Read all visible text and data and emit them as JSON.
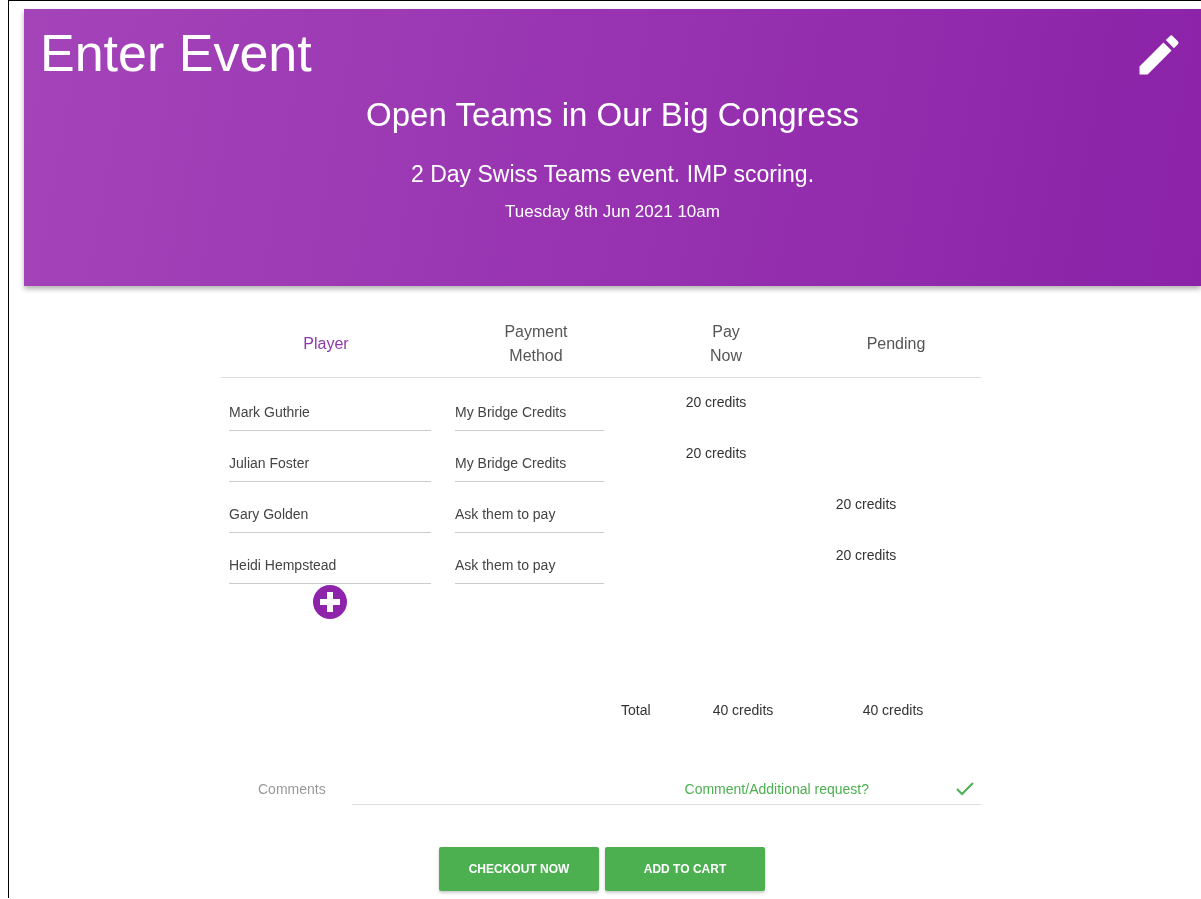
{
  "header": {
    "title": "Enter Event",
    "event_name": "Open Teams in Our Big Congress",
    "description": "2 Day Swiss Teams event. IMP scoring.",
    "date": "Tuesday 8th Jun 2021 10am"
  },
  "table": {
    "columns": [
      {
        "label": "Player",
        "selected": true
      },
      {
        "label": "Payment Method",
        "selected": false
      },
      {
        "label": "Pay Now",
        "selected": false
      },
      {
        "label": "Pending",
        "selected": false
      }
    ],
    "rows": [
      {
        "player": "Mark Guthrie",
        "payment_method": "My Bridge Credits",
        "pay_now": "20 credits"
      },
      {
        "player": "Julian Foster",
        "payment_method": "My Bridge Credits",
        "pay_now": "20 credits"
      },
      {
        "player": "Gary Golden",
        "payment_method": "Ask them to pay",
        "pending": "20 credits"
      },
      {
        "player": "Heidi Hempstead",
        "payment_method": "Ask them to pay",
        "pending": "20 credits"
      }
    ],
    "total": {
      "label": "Total",
      "pay_now": "40 credits",
      "pending": "40 credits"
    }
  },
  "comments": {
    "label": "Comments",
    "placeholder": "Comment/Additional request?",
    "valid": true
  },
  "buttons": [
    "CHECKOUT NOW",
    "ADD TO CART"
  ]
}
